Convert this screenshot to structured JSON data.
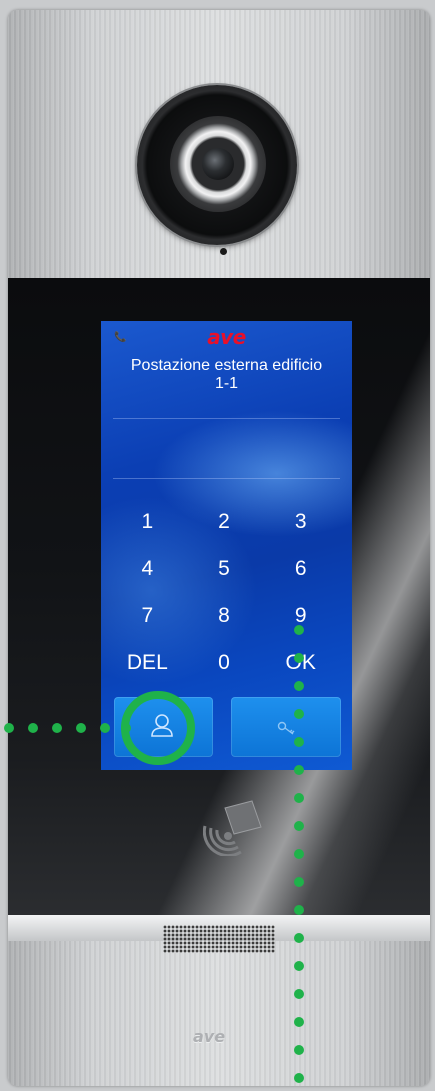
{
  "device": {
    "status_icon": "📞",
    "brand": "ave",
    "title_line1": "Postazione esterna edificio",
    "title_line2": "1-1",
    "bottom_logo": "ave"
  },
  "keypad": {
    "keys": [
      "1",
      "2",
      "3",
      "4",
      "5",
      "6",
      "7",
      "8",
      "9",
      "DEL",
      "0",
      "OK"
    ]
  },
  "buttons": {
    "user_icon": "user-icon",
    "key_icon": "key-icon"
  },
  "colors": {
    "screen_blue": "#0b3fb4",
    "button_blue": "#1e90ee",
    "brand_red": "#e8102a",
    "highlight_green": "#1fb24a"
  }
}
